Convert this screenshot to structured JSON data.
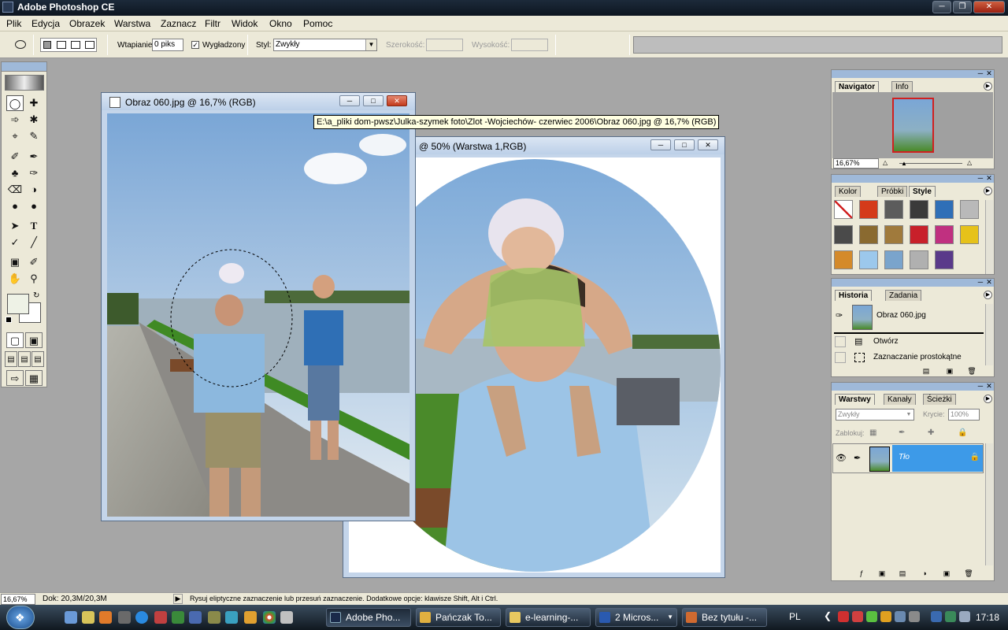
{
  "app": {
    "title": "Adobe Photoshop CE"
  },
  "menu": [
    "Plik",
    "Edycja",
    "Obrazek",
    "Warstwa",
    "Zaznacz",
    "Filtr",
    "Widok",
    "Okno",
    "Pomoc"
  ],
  "options": {
    "feather_label": "Wtapianie",
    "feather_value": "0 piks",
    "antialias_label": "Wygładzony",
    "style_label": "Styl:",
    "style_value": "Zwykły",
    "width_label": "Szerokość:",
    "height_label": "Wysokość:"
  },
  "doc1": {
    "title": "Obraz 060.jpg @ 16,7% (RGB)"
  },
  "doc2": {
    "title": "@ 50% (Warstwa 1,RGB)"
  },
  "tooltip": "E:\\a_pliki dom-pwsz\\Julka-szymek foto\\Zlot -Wojciechów- czerwiec 2006\\Obraz 060.jpg @ 16,7% (RGB)",
  "navigator": {
    "tabs": [
      "Navigator",
      "Info"
    ],
    "zoom": "16,67%"
  },
  "styles_panel": {
    "tabs": [
      "Kolor",
      "Próbki",
      "Style"
    ],
    "swatches": [
      "#ffffff",
      "#d43a1a",
      "#5c5c5c",
      "#3a3a3a",
      "#2f6fb7",
      "#b9b9b9",
      "#4a4a4a",
      "#8a6a30",
      "#a07a3c",
      "#c8202a",
      "#c03080",
      "#e6c21a",
      "#d48a2a",
      "#9cc8ec",
      "#7aa4cc",
      "#b0b0b0",
      "#5a3a8a"
    ]
  },
  "history": {
    "tabs": [
      "Historia",
      "Zadania"
    ],
    "snapshot": "Obraz 060.jpg",
    "items": [
      "Otwórz",
      "Zaznaczanie prostokątne"
    ]
  },
  "layers": {
    "tabs": [
      "Warstwy",
      "Kanały",
      "Ścieżki"
    ],
    "blend": "Zwykły",
    "opacity_label": "Krycie:",
    "opacity": "100%",
    "lock_label": "Zablokuj:",
    "layer_name": "Tło"
  },
  "status": {
    "zoom": "16,67%",
    "doc": "Dok: 20,3M/20,3M",
    "hint": "Rysuj eliptyczne zaznaczenie lub przesuń zaznaczenie. Dodatkowe opcje: klawisze Shift, Alt i Ctrl."
  },
  "taskbar": {
    "tasks": [
      "Adobe Pho...",
      "Pańczak To...",
      "e-learning-...",
      "2 Micros...",
      "Bez tytułu -..."
    ],
    "lang": "PL",
    "clock": "17:18"
  },
  "colors": {
    "accent": "#3d9ae8",
    "layer_selected": "#3d9ae8"
  }
}
